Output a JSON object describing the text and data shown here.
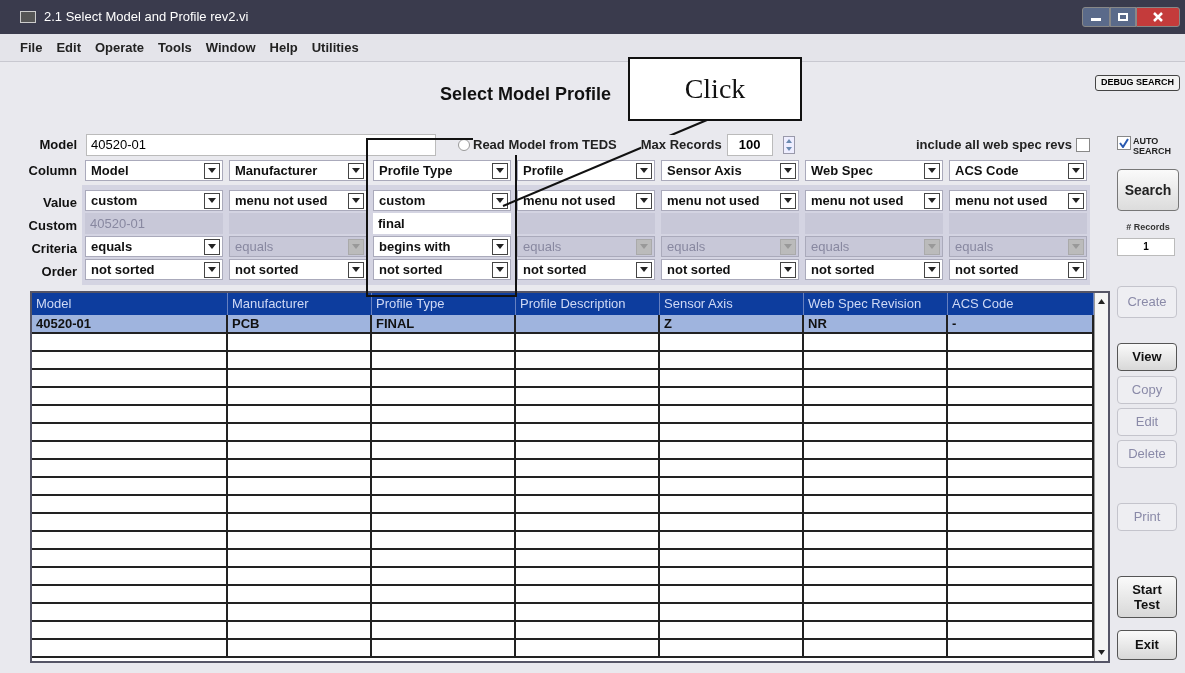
{
  "window": {
    "title": "2.1 Select Model and Profile rev2.vi"
  },
  "menu": [
    "File",
    "Edit",
    "Operate",
    "Tools",
    "Window",
    "Help",
    "Utilities"
  ],
  "heading": "Select Model Profile",
  "debug_button": {
    "label": "DEBUG SEARCH"
  },
  "model": {
    "label": "Model",
    "value": "40520-01"
  },
  "read_teds": {
    "label": "Read Model from TEDS",
    "selected": false
  },
  "max_records": {
    "label": "Max Records",
    "value": "100"
  },
  "include_revs": {
    "label": "include all web spec revs",
    "checked": false
  },
  "auto_search": {
    "label": "AUTO SEARCH",
    "checked": true
  },
  "row_labels": {
    "column": "Column",
    "value": "Value",
    "custom": "Custom",
    "criteria": "Criteria",
    "order": "Order"
  },
  "filters": [
    {
      "column": "Model",
      "value": "custom",
      "custom": {
        "value": "40520-01",
        "disabled": true
      },
      "criteria": {
        "value": "equals",
        "disabled": false
      },
      "order": "not sorted"
    },
    {
      "column": "Manufacturer",
      "value": "menu not used",
      "custom": {
        "disabled": true
      },
      "criteria": {
        "value": "equals",
        "disabled": true
      },
      "order": "not sorted"
    },
    {
      "column": "Profile Type",
      "value": "custom",
      "custom": {
        "value": "final",
        "disabled": false
      },
      "criteria": {
        "value": "begins with",
        "disabled": false
      },
      "order": "not sorted"
    },
    {
      "column": "Profile",
      "value": "menu not used",
      "custom": {
        "disabled": true
      },
      "criteria": {
        "value": "equals",
        "disabled": true
      },
      "order": "not sorted"
    },
    {
      "column": "Sensor Axis",
      "value": "menu not used",
      "custom": {
        "disabled": true
      },
      "criteria": {
        "value": "equals",
        "disabled": true
      },
      "order": "not sorted"
    },
    {
      "column": "Web Spec",
      "value": "menu not used",
      "custom": {
        "disabled": true
      },
      "criteria": {
        "value": "equals",
        "disabled": true
      },
      "order": "not sorted"
    },
    {
      "column": "ACS Code",
      "value": "menu not used",
      "custom": {
        "disabled": true
      },
      "criteria": {
        "value": "equals",
        "disabled": true
      },
      "order": "not sorted"
    }
  ],
  "search_button": {
    "label": "Search"
  },
  "records": {
    "label": "# Records",
    "value": "1"
  },
  "table": {
    "columns": [
      "Model",
      "Manufacturer",
      "Profile Type",
      "Profile Description",
      "Sensor Axis",
      "Web Spec Revision",
      "ACS Code"
    ],
    "rows": [
      {
        "selected": true,
        "cells": [
          "40520-01",
          "PCB",
          "FINAL",
          "",
          "Z",
          "NR",
          "-"
        ]
      }
    ]
  },
  "side_buttons": [
    {
      "label": "Create",
      "disabled": true
    },
    {
      "label": "View",
      "disabled": false
    },
    {
      "label": "Copy",
      "disabled": true
    },
    {
      "label": "Edit",
      "disabled": true
    },
    {
      "label": "Delete",
      "disabled": true
    },
    {
      "label": "Print",
      "disabled": true
    },
    {
      "label": "Start Test",
      "disabled": false
    },
    {
      "label": "Exit",
      "disabled": false
    }
  ],
  "callout": {
    "text": "Click"
  }
}
